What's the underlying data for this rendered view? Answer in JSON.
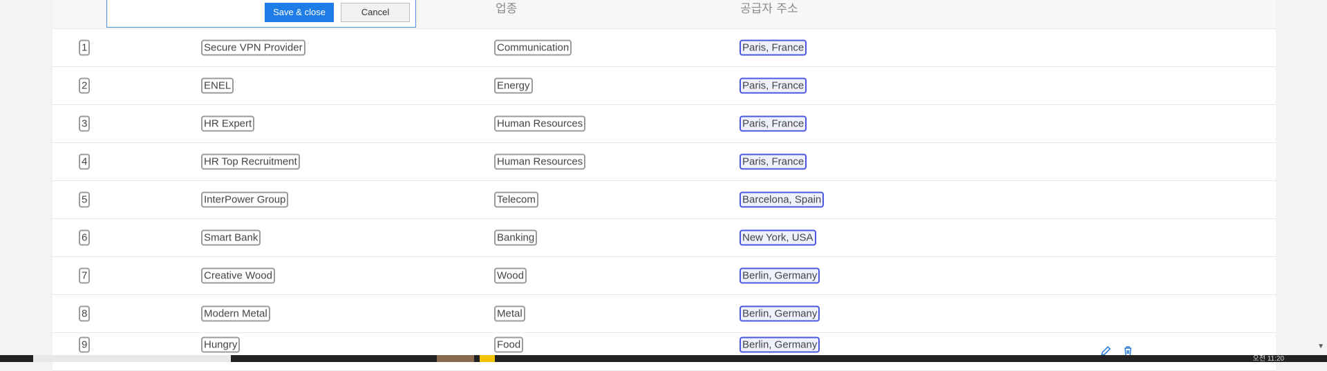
{
  "popup": {
    "save_label": "Save & close",
    "cancel_label": "Cancel"
  },
  "table": {
    "headers": {
      "industry": "업종",
      "address": "공급자 주소"
    },
    "rows": [
      {
        "num": "1",
        "name": "Secure VPN Provider",
        "industry": "Communication",
        "address": "Paris, France"
      },
      {
        "num": "2",
        "name": "ENEL",
        "industry": "Energy",
        "address": "Paris, France"
      },
      {
        "num": "3",
        "name": "HR Expert",
        "industry": "Human Resources",
        "address": "Paris, France"
      },
      {
        "num": "4",
        "name": "HR Top Recruitment",
        "industry": "Human Resources",
        "address": "Paris, France"
      },
      {
        "num": "5",
        "name": "InterPower Group",
        "industry": "Telecom",
        "address": "Barcelona, Spain"
      },
      {
        "num": "6",
        "name": "Smart Bank",
        "industry": "Banking",
        "address": "New York, USA"
      },
      {
        "num": "7",
        "name": "Creative Wood",
        "industry": "Wood",
        "address": "Berlin, Germany"
      },
      {
        "num": "8",
        "name": "Modern Metal",
        "industry": "Metal",
        "address": "Berlin, Germany"
      },
      {
        "num": "9",
        "name": "Hungry",
        "industry": "Food",
        "address": "Berlin, Germany"
      }
    ]
  },
  "taskbar": {
    "clock": "오전 11:20"
  },
  "icons": {
    "edit": "pencil-icon",
    "delete": "trash-icon",
    "scroll_down": "scroll-down-arrow-icon"
  },
  "colors": {
    "primary": "#1e7ce6",
    "address_border": "#4b57e0",
    "taskbar": "#222222"
  }
}
